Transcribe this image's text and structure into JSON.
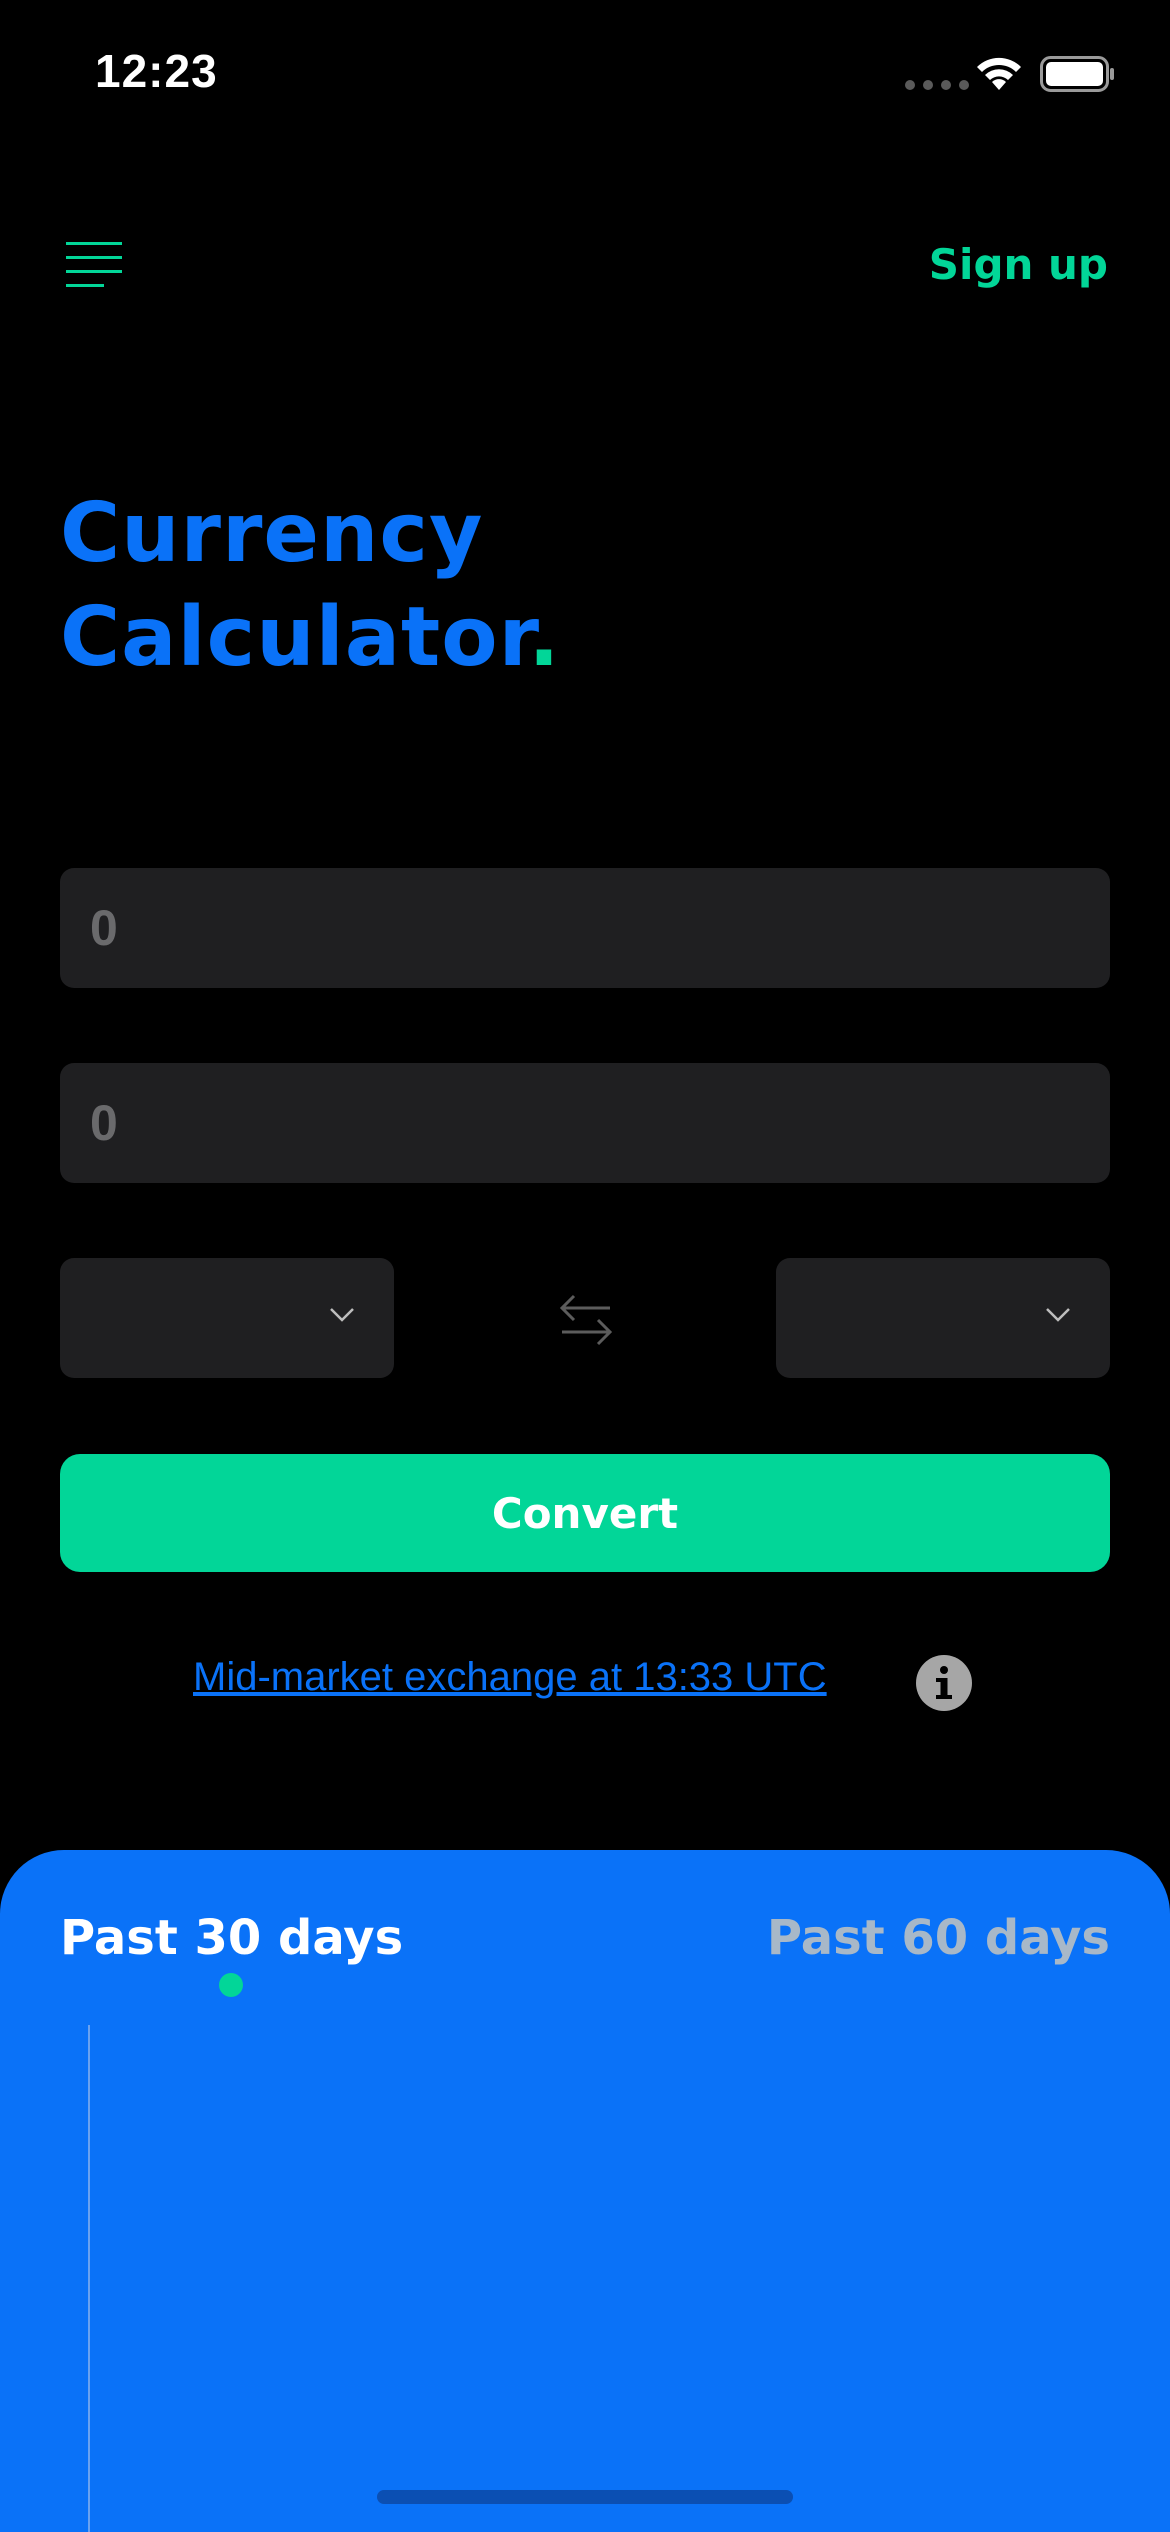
{
  "status_bar": {
    "time": "12:23"
  },
  "header": {
    "signup_label": "Sign up"
  },
  "title": {
    "line1": "Currency",
    "line2": "Calculator",
    "dot": "."
  },
  "inputs": {
    "amount_from": {
      "value": "",
      "placeholder": "0"
    },
    "amount_to": {
      "value": "",
      "placeholder": "0"
    }
  },
  "selects": {
    "from_currency": "",
    "to_currency": ""
  },
  "convert_label": "Convert",
  "rate_link": "Mid-market exchange at 13:33 UTC",
  "chart": {
    "tabs": [
      {
        "label": "Past 30 days",
        "active": true
      },
      {
        "label": "Past 60 days",
        "active": false
      }
    ]
  },
  "colors": {
    "accent_green": "#02d698",
    "accent_blue": "#0a72f8",
    "field_bg": "#1f1f21"
  },
  "icons": {
    "menu": "hamburger-menu-icon",
    "swap": "swap-arrows-icon",
    "chevron": "chevron-down-icon",
    "info": "info-icon"
  }
}
